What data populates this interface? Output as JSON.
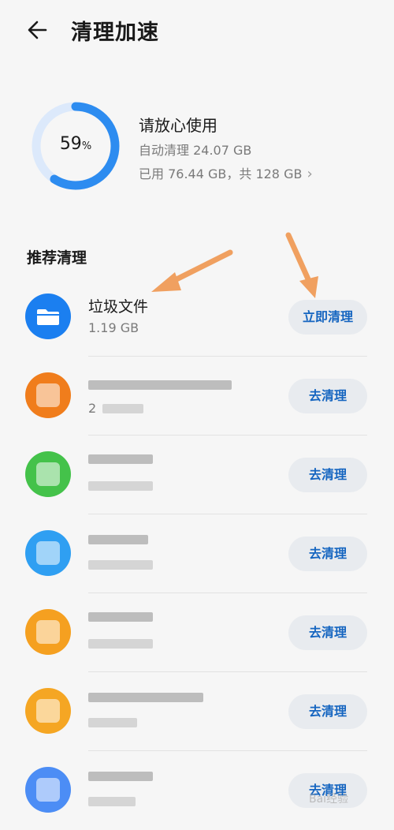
{
  "header": {
    "title": "清理加速"
  },
  "storage": {
    "percent": "59",
    "percent_unit": "%",
    "percent_value": 0.59,
    "headline": "请放心使用",
    "auto_clean": "自动清理 24.07 GB",
    "usage": "已用 76.44 GB，共 128 GB"
  },
  "section": {
    "title": "推荐清理"
  },
  "junk": {
    "name": "垃圾文件",
    "size": "1.19 GB",
    "button": "立即清理"
  },
  "apps": [
    {
      "button": "去清理",
      "size": "2"
    },
    {
      "button": "去清理"
    },
    {
      "button": "去清理"
    },
    {
      "button": "去清理"
    },
    {
      "button": "去清理"
    },
    {
      "button": "去清理"
    }
  ],
  "colors": {
    "accent": "#1565c0",
    "ring": "#2d8cf0",
    "ring_track": "#dce9fb",
    "annotation_arrow": "#f0a060"
  },
  "watermark": "Bai经验"
}
